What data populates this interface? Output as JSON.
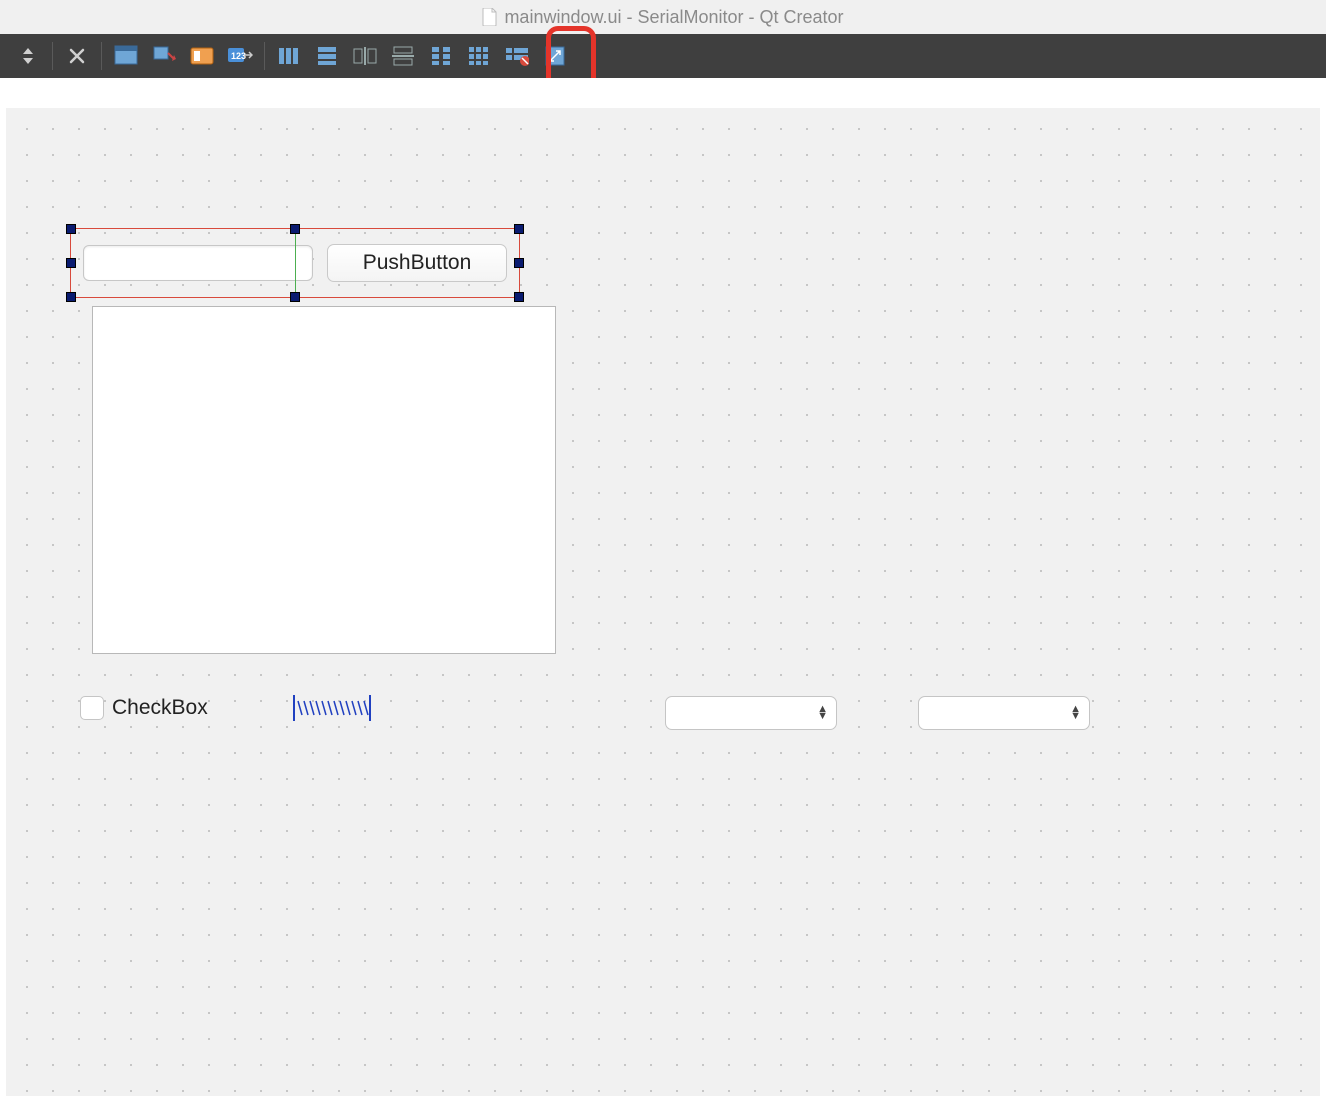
{
  "window": {
    "title": "mainwindow.ui - SerialMonitor - Qt Creator"
  },
  "toolbar": {
    "buttons": [
      {
        "name": "up-down-icon"
      },
      {
        "name": "close-icon"
      },
      {
        "name": "edit-widgets-icon"
      },
      {
        "name": "edit-signals-icon"
      },
      {
        "name": "edit-buddies-icon"
      },
      {
        "name": "edit-tab-order-icon"
      },
      {
        "name": "layout-horizontal-icon"
      },
      {
        "name": "layout-vertical-icon"
      },
      {
        "name": "layout-horizontal-splitter-icon"
      },
      {
        "name": "layout-vertical-splitter-icon"
      },
      {
        "name": "layout-grid-2col-icon"
      },
      {
        "name": "layout-grid-icon"
      },
      {
        "name": "layout-form-icon"
      },
      {
        "name": "break-layout-icon"
      },
      {
        "name": "adjust-size-icon"
      }
    ]
  },
  "widgets": {
    "pushbutton_label": "PushButton",
    "checkbox_label": "CheckBox",
    "lineedit_value": "",
    "combo1_value": "",
    "combo2_value": ""
  }
}
